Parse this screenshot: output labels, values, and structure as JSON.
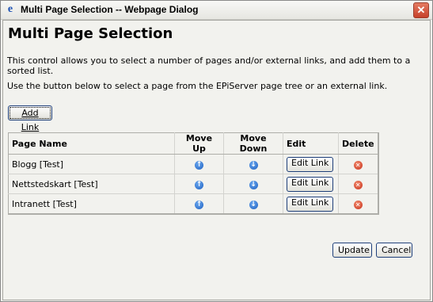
{
  "window": {
    "title": "Multi Page Selection -- Webpage Dialog",
    "ie_icon": "e",
    "close_glyph": "✕"
  },
  "page": {
    "heading": "Multi Page Selection",
    "desc1": "This control allows you to select a number of pages and/or external links, and add them to a sorted list.",
    "desc2": "Use the button below to select a page from the EPiServer page tree or an external link."
  },
  "buttons": {
    "add_link": "Add Link",
    "update": "Update",
    "cancel": "Cancel"
  },
  "table": {
    "headers": {
      "name": "Page Name",
      "up": "Move Up",
      "down": "Move Down",
      "edit": "Edit",
      "delete": "Delete"
    },
    "edit_label": "Edit Link",
    "rows": [
      {
        "name": "Blogg [Test]"
      },
      {
        "name": "Nettstedskart [Test]"
      },
      {
        "name": "Intranett [Test]"
      }
    ]
  },
  "icons": {
    "up": "arrow-up-icon",
    "down": "arrow-down-icon",
    "delete": "delete-icon"
  },
  "colors": {
    "arrow": "#1e5fbf",
    "delete": "#c7301b"
  }
}
